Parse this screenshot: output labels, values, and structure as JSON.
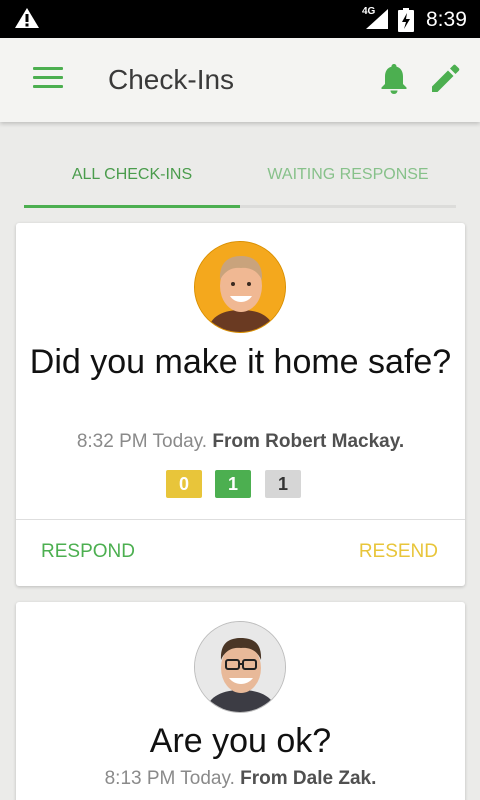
{
  "status_bar": {
    "network": "4G",
    "time": "8:39",
    "icons": [
      "warning-icon",
      "signal-icon",
      "battery-charging-icon"
    ]
  },
  "app_bar": {
    "title": "Check-Ins",
    "icons": [
      "menu-icon",
      "bell-icon",
      "pencil-icon"
    ]
  },
  "tabs": {
    "all": "ALL CHECK-INS",
    "waiting": "WAITING RESPONSE",
    "selected": "ALL CHECK-INS"
  },
  "colors": {
    "accent": "#4caf50",
    "warning": "#e8c53a"
  },
  "checkins": [
    {
      "question": "Did you make it home safe?",
      "time": "8:32 PM Today.",
      "from": "From Robert Mackay.",
      "counts": [
        "0",
        "1",
        "1"
      ],
      "respond_label": "RESPOND",
      "resend_label": "RESEND"
    },
    {
      "question": "Are you ok?",
      "time": "8:13 PM Today.",
      "from": "From Dale Zak."
    }
  ]
}
